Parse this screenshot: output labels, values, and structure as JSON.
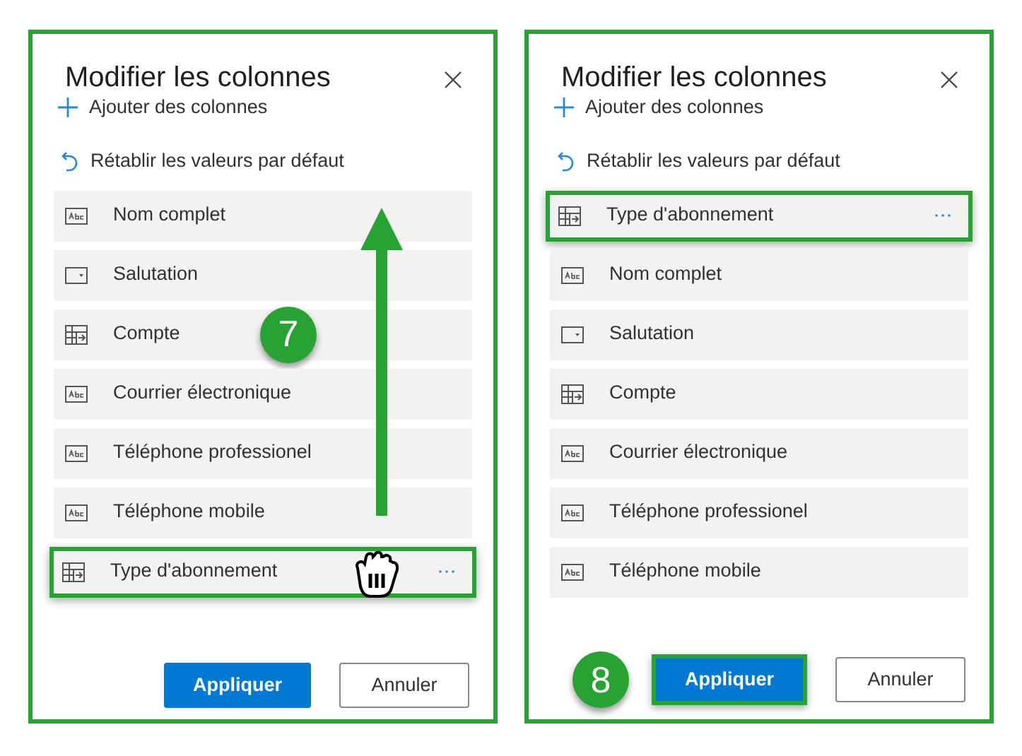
{
  "panels": [
    {
      "title": "Modifier les colonnes",
      "add_label": "Ajouter des colonnes",
      "reset_label": "Rétablir les valeurs par défaut",
      "drag_arrow": true,
      "apply": {
        "label": "Appliquer",
        "highlighted": false
      },
      "cancel": "Annuler",
      "columns": [
        {
          "label": "Nom complet",
          "kind": "text",
          "highlighted": false,
          "more": false,
          "dragging": false
        },
        {
          "label": "Salutation",
          "kind": "choice",
          "highlighted": false,
          "more": false,
          "dragging": false
        },
        {
          "label": "Compte",
          "kind": "lookup",
          "highlighted": false,
          "more": false,
          "dragging": false,
          "step": "7"
        },
        {
          "label": "Courrier électronique",
          "kind": "text",
          "highlighted": false,
          "more": false,
          "dragging": false
        },
        {
          "label": "Téléphone professionel",
          "kind": "text",
          "highlighted": false,
          "more": false,
          "dragging": false
        },
        {
          "label": "Téléphone mobile",
          "kind": "text",
          "highlighted": false,
          "more": false,
          "dragging": false
        },
        {
          "label": "Type d'abonnement",
          "kind": "lookup",
          "highlighted": true,
          "more": true,
          "dragging": true
        }
      ]
    },
    {
      "title": "Modifier les colonnes",
      "add_label": "Ajouter des colonnes",
      "reset_label": "Rétablir les valeurs par défaut",
      "drag_arrow": false,
      "apply": {
        "label": "Appliquer",
        "highlighted": true,
        "step": "8"
      },
      "cancel": "Annuler",
      "columns": [
        {
          "label": "Type d'abonnement",
          "kind": "lookup",
          "highlighted": true,
          "more": true,
          "dragging": false
        },
        {
          "label": "Nom complet",
          "kind": "text",
          "highlighted": false,
          "more": false,
          "dragging": false
        },
        {
          "label": "Salutation",
          "kind": "choice",
          "highlighted": false,
          "more": false,
          "dragging": false
        },
        {
          "label": "Compte",
          "kind": "lookup",
          "highlighted": false,
          "more": false,
          "dragging": false
        },
        {
          "label": "Courrier électronique",
          "kind": "text",
          "highlighted": false,
          "more": false,
          "dragging": false
        },
        {
          "label": "Téléphone professionel",
          "kind": "text",
          "highlighted": false,
          "more": false,
          "dragging": false
        },
        {
          "label": "Téléphone mobile",
          "kind": "text",
          "highlighted": false,
          "more": false,
          "dragging": false
        }
      ]
    }
  ]
}
